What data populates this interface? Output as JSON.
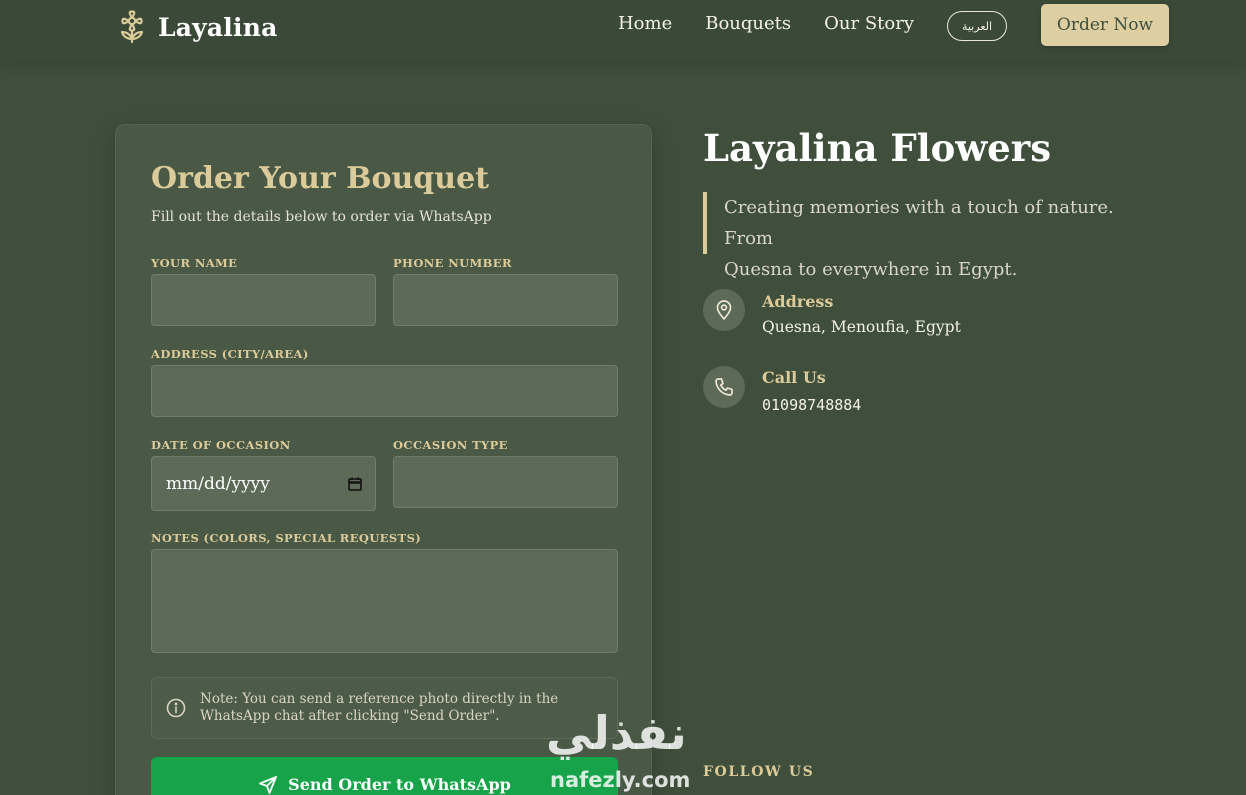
{
  "header": {
    "brand_name": "Layalina",
    "brand_icon": "flower-icon",
    "nav": [
      {
        "label": "Home"
      },
      {
        "label": "Bouquets"
      },
      {
        "label": "Our Story"
      }
    ],
    "lang_button": "العربية",
    "order_button": "Order Now"
  },
  "form": {
    "title": "Order Your Bouquet",
    "subtitle": "Fill out the details below to order via WhatsApp",
    "name_label": "YOUR NAME",
    "name_value": "",
    "phone_label": "PHONE NUMBER",
    "phone_value": "",
    "address_label": "ADDRESS (CITY/AREA)",
    "address_value": "",
    "date_label": "DATE OF OCCASION",
    "date_value": "mm/dd/yyyy",
    "occasion_label": "OCCASION TYPE",
    "occasion_value": "",
    "notes_label": "NOTES (COLORS, SPECIAL REQUESTS)",
    "notes_value": "",
    "note_line1": "Note: You can send a reference photo directly in the",
    "note_line2": "WhatsApp chat after clicking \"Send Order\".",
    "submit_label": "Send Order to WhatsApp"
  },
  "info": {
    "title": "Layalina Flowers",
    "quote_line1": "Creating memories with a touch of nature. From",
    "quote_line2": "Quesna to everywhere in Egypt.",
    "address_label": "Address",
    "address_value": "Quesna, Menoufia, Egypt",
    "call_label": "Call Us",
    "call_value": "01098748884",
    "follow_label": "FOLLOW US"
  },
  "watermark": {
    "arabic": "نفذلي",
    "latin": "nafezly.com"
  },
  "colors": {
    "background": "#3f4f3c",
    "accent_gold": "#dccb9a",
    "whatsapp_green": "#16a34a"
  }
}
